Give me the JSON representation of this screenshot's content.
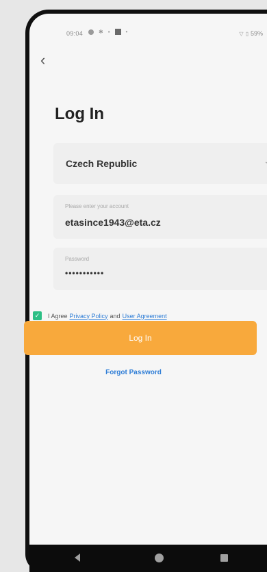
{
  "status_bar": {
    "time": "09:04",
    "right_text": "59%"
  },
  "header": {
    "back_icon": "chevron-left-icon",
    "title": "Log In"
  },
  "form": {
    "region_value": "Czech Republic",
    "account_placeholder": "Please enter your account",
    "account_value": "etasince1943@eta.cz",
    "password_placeholder": "Password",
    "password_value": "•••••••••••"
  },
  "agreement": {
    "checked": true,
    "prefix": "I Agree",
    "privacy_link": "Privacy Policy",
    "and": "and",
    "user_link": "User Agreement"
  },
  "actions": {
    "login_label": "Log In",
    "forgot_label": "Forgot Password"
  },
  "colors": {
    "accent": "#f8a93c",
    "link": "#2e7dd6",
    "checkbox": "#2cbf85"
  }
}
